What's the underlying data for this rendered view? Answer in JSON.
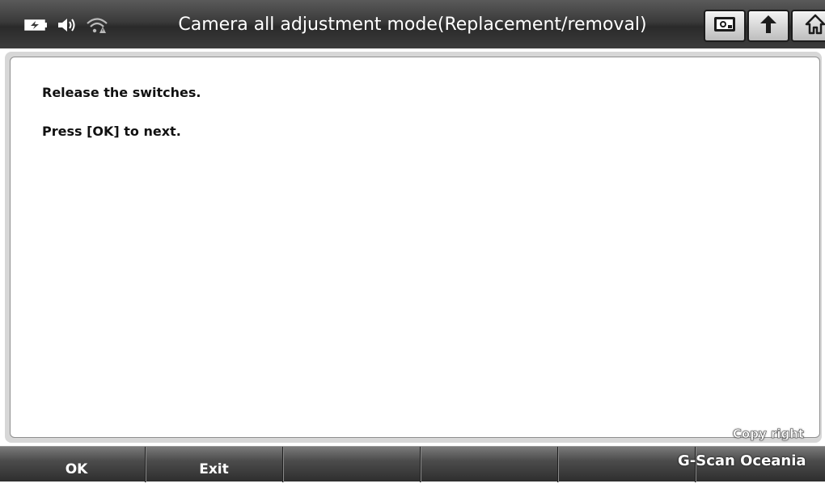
{
  "header": {
    "title": "Camera all adjustment mode(Replacement/removal)",
    "status_icons": [
      "battery-charging-icon",
      "speaker-volume-icon",
      "wifi-signal-icon"
    ],
    "buttons": [
      {
        "icon": "camera-capture-icon"
      },
      {
        "icon": "back-arrow-icon"
      },
      {
        "icon": "home-icon"
      }
    ]
  },
  "content": {
    "lines": [
      "Release the switches.",
      "Press [OK] to next."
    ]
  },
  "footer": {
    "buttons": [
      "OK",
      "Exit",
      "",
      "",
      "",
      ""
    ]
  },
  "watermark": {
    "line1": "Copy right",
    "line2": "G-Scan Oceania"
  },
  "colors": {
    "header_bg": "#3a3a3a",
    "footer_bg": "#4c4c4c",
    "panel_bg": "#ffffff",
    "text": "#111111"
  }
}
